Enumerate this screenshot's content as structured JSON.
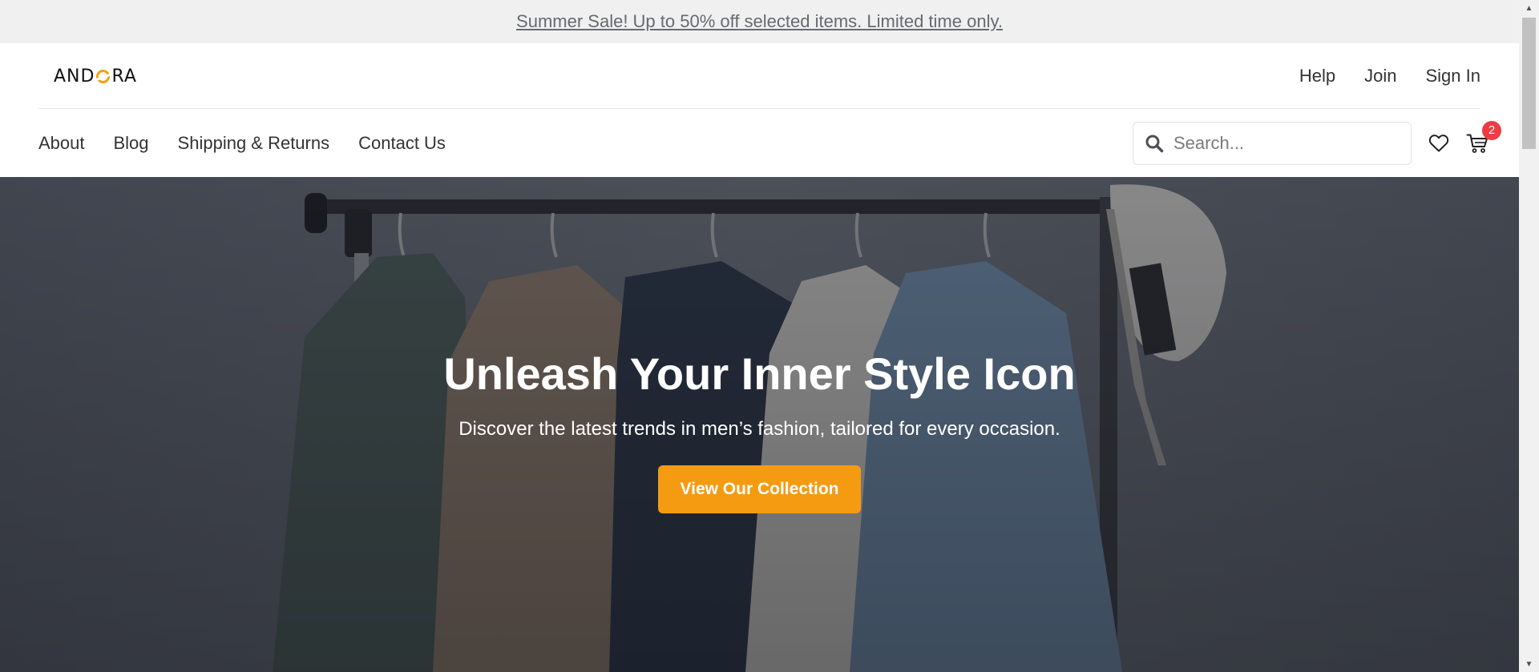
{
  "announcement": {
    "text": "Summer Sale! Up to 50% off selected items. Limited time only."
  },
  "brand": {
    "logo_left": "AND",
    "logo_right": "RA",
    "accent_color": "#f5a10c"
  },
  "account_links": {
    "help": "Help",
    "join": "Join",
    "sign_in": "Sign In"
  },
  "main_nav": {
    "items": [
      "About",
      "Blog",
      "Shipping & Returns",
      "Contact Us"
    ]
  },
  "search": {
    "placeholder": "Search..."
  },
  "cart": {
    "count": "2",
    "badge_color": "#ef3b43"
  },
  "icons": {
    "search": "search-icon",
    "wishlist": "heart-icon",
    "cart": "cart-icon"
  },
  "hero": {
    "title": "Unleash Your Inner Style Icon",
    "subtitle": "Discover the latest trends in men’s fashion, tailored for every occasion.",
    "cta_label": "View Our Collection",
    "cta_color": "#f59b12"
  }
}
